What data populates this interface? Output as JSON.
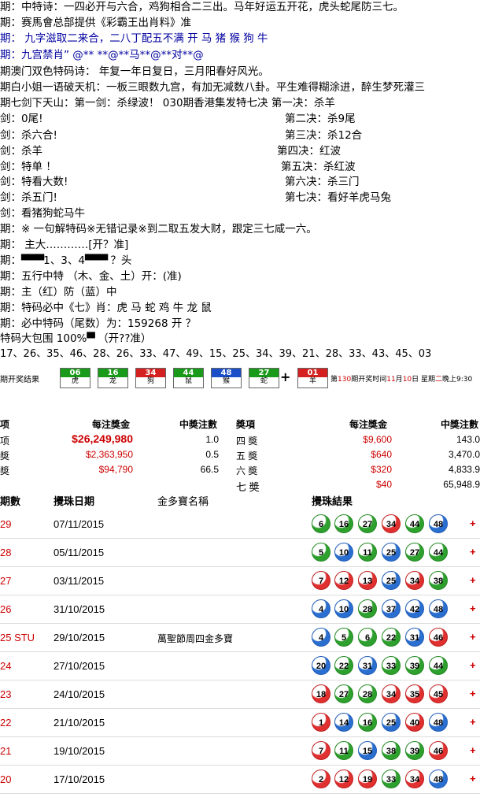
{
  "top_lines": [
    "期：中特诗：一四必开与六合，鸡狗相合二三出。马年好运五开花，虎头蛇尾防三七。",
    "期：赛馬會总部提供《彩霸王出肖料》准",
    "期：  九字滋取二来合，二八丁配五不满      开 马 猪 猴 狗 牛",
    "期：九宫禁肖”   @** **@**马**@**对**@",
    "期澳门双色特码诗：  年复一年日复日，三月阳春好风光。",
    "期白小姐一语破天机：一板三眼数九宫，有加无减数八卦。平生难得糊涂进，醉生梦死灌三",
    "期七剑下天山：第一剑：杀绿波！        030期香港集发特七决  第一决：杀羊",
    "剑：0尾!",
    "剑：杀六合!",
    "剑：杀羊",
    "剑：特单 ！",
    "剑：特看大数!",
    "剑：杀五门!",
    "剑：看猪狗蛇马牛",
    "期：※ 一句解特码※无错记录※到二取五发大财，跟定三七咸一六。",
    "期：  主大…………[开？准]",
    "期：",
    "期：五行中特   （木、金、土）开：(准)",
    "期：主（红）防（蓝）中",
    "期：特码必中《七》肖：虎 马 蛇 鸡 牛 龙 鼠",
    "期：必中特码（尾数）为：159268   开 ？",
    "特码大包围 100%",
    "  17、26、35、46、28、26、33、47、49、15、25、34、39、21、28、33、43、45、03"
  ],
  "bars_line": {
    "bars_a": "▀▀▀",
    "mid": "1、3、4",
    "bars_b": "▀▀▀",
    "tail": " ？头"
  },
  "big_line": {
    "bars": "▀",
    "tail": "  （开??准）"
  },
  "jue": [
    "第二决：杀9尾",
    "第三决：杀12合",
    "第四决：红波",
    "第五决：杀红波",
    "第六决：杀三门",
    "第七决：看好羊虎马兔"
  ],
  "strip": {
    "label": "期开奖结果",
    "tiles": [
      {
        "num": "06",
        "zodiac": "虎",
        "color": "#1a9a1a"
      },
      {
        "num": "16",
        "zodiac": "龙",
        "color": "#1a9a1a"
      },
      {
        "num": "34",
        "zodiac": "狗",
        "color": "#d42020"
      },
      {
        "num": "44",
        "zodiac": "鼠",
        "color": "#1a9a1a"
      },
      {
        "num": "48",
        "zodiac": "猴",
        "color": "#1c4ec8"
      },
      {
        "num": "27",
        "zodiac": "蛇",
        "color": "#1a9a1a"
      }
    ],
    "plus": "+",
    "special": {
      "num": "01",
      "zodiac": "羊",
      "color": "#d42020"
    },
    "info_a": "第",
    "info_period": "130",
    "info_b": "期开奖时间",
    "info_month": "11",
    "info_c": "月",
    "info_day": "10",
    "info_d": "日 星期",
    "info_weekday": "二",
    "info_e": "晚上9:30"
  },
  "prize": {
    "headers": {
      "item": "项",
      "per": "每注獎金",
      "count": "中奬注數",
      "item2": "奬項",
      "per2": "每注獎金",
      "count2": "中獎注數"
    },
    "left": [
      {
        "label": "项",
        "amount": "$26,249,980",
        "count": "1.0"
      },
      {
        "label": "奬",
        "amount": "$2,363,950",
        "count": "0.5"
      },
      {
        "label": "奬",
        "amount": "$94,790",
        "count": "66.5"
      }
    ],
    "right": [
      {
        "label": "四 奬",
        "amount": "$9,600",
        "count": "143.0"
      },
      {
        "label": "五 奬",
        "amount": "$640",
        "count": "3,470.0"
      },
      {
        "label": "六 奬",
        "amount": "$320",
        "count": "4,833.9"
      },
      {
        "label": "七 奬",
        "amount": "$40",
        "count": "65,948.9"
      }
    ]
  },
  "history": {
    "headers": {
      "period": "期數",
      "date": "攪珠日期",
      "name": "金多寶名稱",
      "result": "攪珠結果"
    },
    "rows": [
      {
        "period": "29",
        "date": "07/11/2015",
        "name": "",
        "balls": [
          [
            "6",
            "green"
          ],
          [
            "16",
            "green"
          ],
          [
            "27",
            "green"
          ],
          [
            "34",
            "red"
          ],
          [
            "44",
            "green"
          ],
          [
            "48",
            "blue"
          ]
        ]
      },
      {
        "period": "28",
        "date": "05/11/2015",
        "name": "",
        "balls": [
          [
            "5",
            "green"
          ],
          [
            "10",
            "blue"
          ],
          [
            "11",
            "green"
          ],
          [
            "25",
            "blue"
          ],
          [
            "27",
            "green"
          ],
          [
            "44",
            "green"
          ]
        ]
      },
      {
        "period": "27",
        "date": "03/11/2015",
        "name": "",
        "balls": [
          [
            "7",
            "red"
          ],
          [
            "12",
            "red"
          ],
          [
            "13",
            "red"
          ],
          [
            "25",
            "blue"
          ],
          [
            "34",
            "red"
          ],
          [
            "38",
            "green"
          ]
        ]
      },
      {
        "period": "26",
        "date": "31/10/2015",
        "name": "",
        "balls": [
          [
            "4",
            "blue"
          ],
          [
            "10",
            "blue"
          ],
          [
            "28",
            "green"
          ],
          [
            "37",
            "blue"
          ],
          [
            "42",
            "blue"
          ],
          [
            "48",
            "blue"
          ]
        ]
      },
      {
        "period": "25 STU",
        "date": "29/10/2015",
        "name": "萬聖節周四金多寶",
        "balls": [
          [
            "4",
            "blue"
          ],
          [
            "5",
            "green"
          ],
          [
            "6",
            "green"
          ],
          [
            "22",
            "green"
          ],
          [
            "31",
            "blue"
          ],
          [
            "46",
            "red"
          ]
        ]
      },
      {
        "period": "24",
        "date": "27/10/2015",
        "name": "",
        "balls": [
          [
            "20",
            "blue"
          ],
          [
            "22",
            "green"
          ],
          [
            "31",
            "blue"
          ],
          [
            "33",
            "green"
          ],
          [
            "39",
            "green"
          ],
          [
            "44",
            "green"
          ]
        ]
      },
      {
        "period": "23",
        "date": "24/10/2015",
        "name": "",
        "balls": [
          [
            "18",
            "red"
          ],
          [
            "27",
            "green"
          ],
          [
            "28",
            "green"
          ],
          [
            "34",
            "red"
          ],
          [
            "35",
            "red"
          ],
          [
            "45",
            "red"
          ]
        ]
      },
      {
        "period": "22",
        "date": "21/10/2015",
        "name": "",
        "balls": [
          [
            "1",
            "red"
          ],
          [
            "14",
            "blue"
          ],
          [
            "16",
            "green"
          ],
          [
            "25",
            "blue"
          ],
          [
            "40",
            "red"
          ],
          [
            "48",
            "blue"
          ]
        ]
      },
      {
        "period": "21",
        "date": "19/10/2015",
        "name": "",
        "balls": [
          [
            "7",
            "red"
          ],
          [
            "11",
            "green"
          ],
          [
            "15",
            "blue"
          ],
          [
            "38",
            "green"
          ],
          [
            "39",
            "green"
          ],
          [
            "46",
            "red"
          ]
        ]
      },
      {
        "period": "20",
        "date": "17/10/2015",
        "name": "",
        "balls": [
          [
            "2",
            "red"
          ],
          [
            "12",
            "red"
          ],
          [
            "19",
            "red"
          ],
          [
            "33",
            "green"
          ],
          [
            "34",
            "red"
          ],
          [
            "48",
            "blue"
          ]
        ]
      }
    ],
    "plus": "+"
  }
}
